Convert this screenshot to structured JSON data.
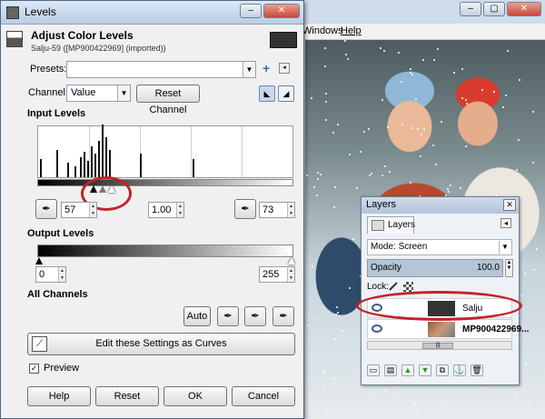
{
  "background_window": {
    "menus": [
      "Windows",
      "Help"
    ]
  },
  "levels_dialog": {
    "window_title": "Levels",
    "header_title": "Adjust Color Levels",
    "header_subtitle": "Salju-59 ([MP900422969] (imported))",
    "presets_label": "Presets:",
    "presets_value": "",
    "channel_label": "Channel:",
    "channel_value": "Value",
    "reset_channel_label": "Reset Channel",
    "input_levels_label": "Input Levels",
    "input_low": "57",
    "input_gamma": "1.00",
    "input_high": "73",
    "output_levels_label": "Output Levels",
    "output_low": "0",
    "output_high": "255",
    "all_channels_label": "All Channels",
    "auto_label": "Auto",
    "edit_curves_label": "Edit these Settings as Curves",
    "preview_label": "Preview",
    "preview_checked": true,
    "buttons": {
      "help": "Help",
      "reset": "Reset",
      "ok": "OK",
      "cancel": "Cancel"
    }
  },
  "layers_dialog": {
    "window_title": "Layers",
    "tab_label": "Layers",
    "mode_label": "Mode: Screen",
    "opacity_label": "Opacity",
    "opacity_value": "100.0",
    "lock_label": "Lock:",
    "layers": [
      {
        "name": "Salju",
        "bold": false
      },
      {
        "name": "MP900422969...",
        "bold": true
      }
    ]
  },
  "colors": {
    "annotation_red": "#c0232c",
    "titlebar": "#c5d6ea"
  }
}
